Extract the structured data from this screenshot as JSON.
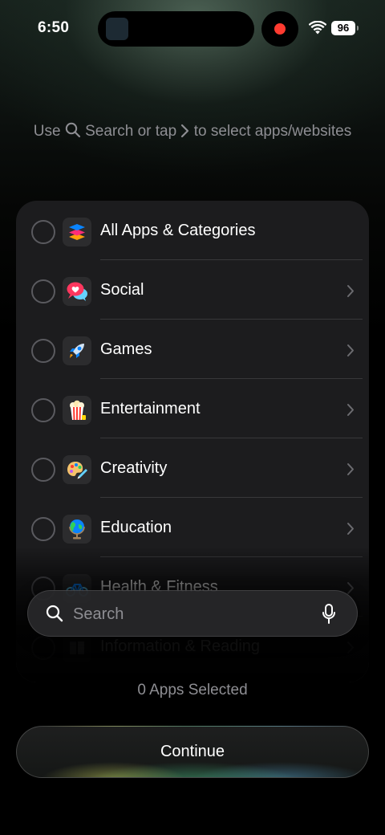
{
  "status_bar": {
    "time": "6:50",
    "battery": "96"
  },
  "hint": {
    "prefix": "Use",
    "search_word": "Search",
    "middle": "or tap",
    "suffix": "to select apps/websites"
  },
  "categories": [
    {
      "label": "All Apps & Categories",
      "icon": "stack-layers-icon",
      "has_chevron": false
    },
    {
      "label": "Social",
      "icon": "speech-bubble-heart-icon",
      "has_chevron": true
    },
    {
      "label": "Games",
      "icon": "rocket-icon",
      "has_chevron": true
    },
    {
      "label": "Entertainment",
      "icon": "popcorn-icon",
      "has_chevron": true
    },
    {
      "label": "Creativity",
      "icon": "palette-icon",
      "has_chevron": true
    },
    {
      "label": "Education",
      "icon": "globe-icon",
      "has_chevron": true
    },
    {
      "label": "Health & Fitness",
      "icon": "bicycle-icon",
      "has_chevron": true
    },
    {
      "label": "Information & Reading",
      "icon": "book-icon",
      "has_chevron": true
    }
  ],
  "search": {
    "placeholder": "Search"
  },
  "selection_status": "0 Apps Selected",
  "continue_label": "Continue",
  "colors": {
    "background": "#000000",
    "card": "#1c1c1e",
    "secondary_text": "#8e8e93",
    "record_dot": "#ff3b30"
  }
}
